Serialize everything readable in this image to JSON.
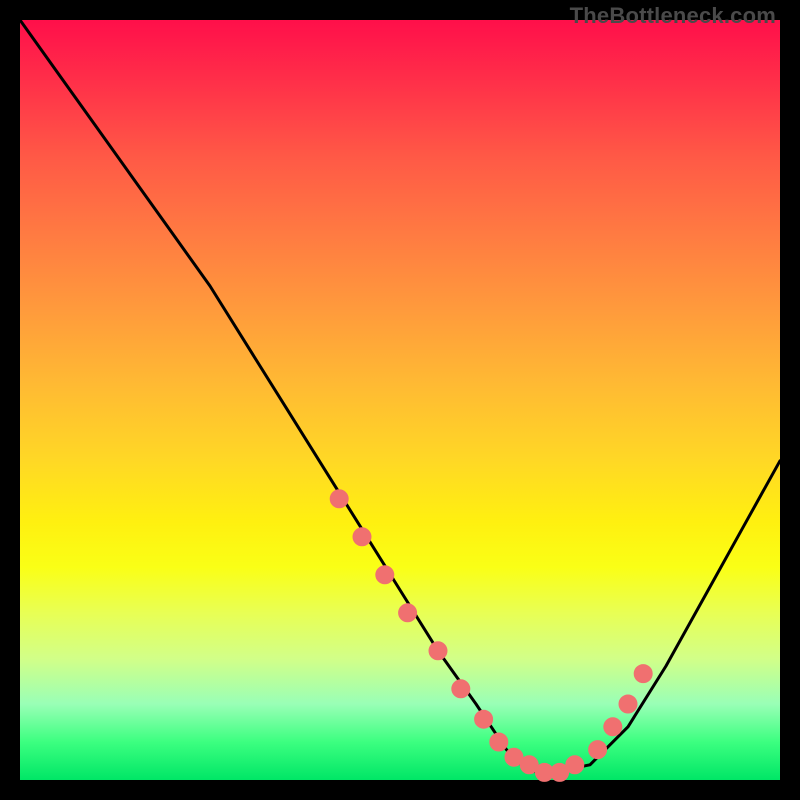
{
  "watermark": "TheBottleneck.com",
  "colors": {
    "curve_stroke": "#000000",
    "marker_fill": "#f07070",
    "marker_stroke": "#f07070"
  },
  "chart_data": {
    "type": "line",
    "title": "",
    "xlabel": "",
    "ylabel": "",
    "xlim": [
      0,
      100
    ],
    "ylim": [
      0,
      100
    ],
    "x": [
      0,
      5,
      10,
      15,
      20,
      25,
      30,
      35,
      40,
      45,
      50,
      55,
      60,
      62,
      64,
      66,
      68,
      70,
      75,
      80,
      85,
      90,
      95,
      100
    ],
    "values": [
      100,
      93,
      86,
      79,
      72,
      65,
      57,
      49,
      41,
      33,
      25,
      17,
      10,
      7,
      4,
      2,
      1,
      1,
      2,
      7,
      15,
      24,
      33,
      42
    ],
    "marker_x": [
      42,
      45,
      48,
      51,
      55,
      58,
      61,
      63,
      65,
      67,
      69,
      71,
      73,
      76,
      78,
      80,
      82
    ],
    "marker_values": [
      37,
      32,
      27,
      22,
      17,
      12,
      8,
      5,
      3,
      2,
      1,
      1,
      2,
      4,
      7,
      10,
      14
    ]
  }
}
